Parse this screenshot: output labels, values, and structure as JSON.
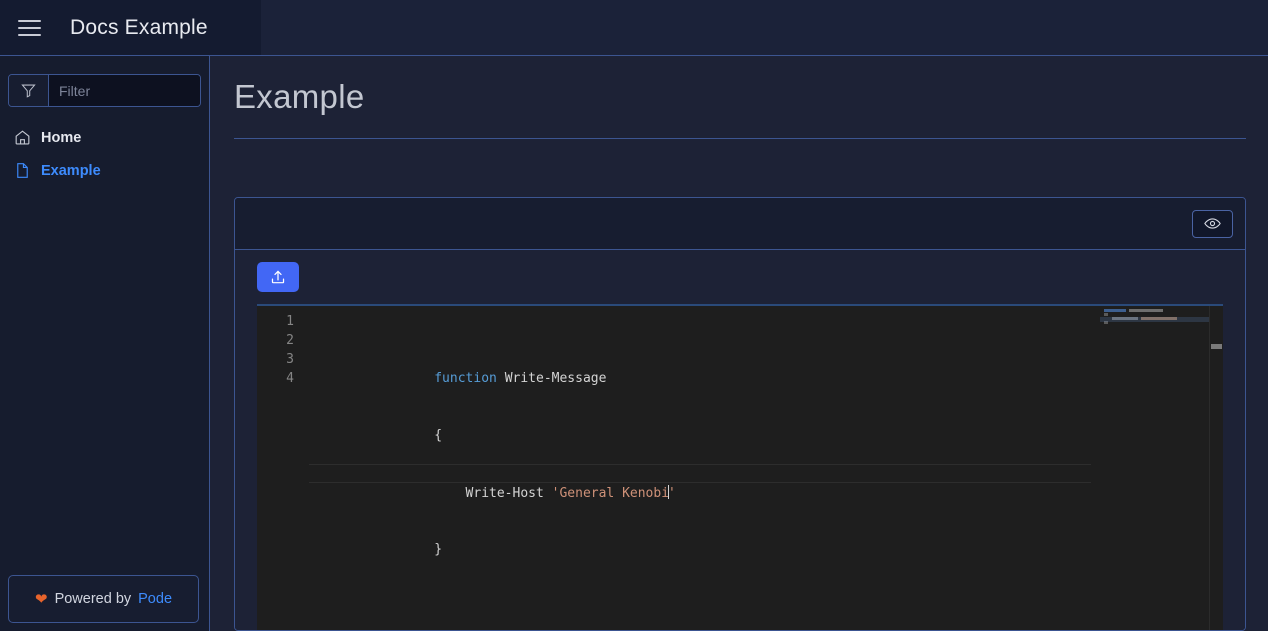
{
  "header": {
    "menu_icon": "hamburger-icon",
    "title": "Docs Example"
  },
  "sidebar": {
    "filter": {
      "icon": "funnel-icon",
      "placeholder": "Filter",
      "value": ""
    },
    "items": [
      {
        "label": "Home",
        "icon": "home-icon",
        "active": false
      },
      {
        "label": "Example",
        "icon": "file-icon",
        "active": true
      }
    ],
    "footer": {
      "heart": "❤",
      "text": "Powered by",
      "link": "Pode"
    }
  },
  "main": {
    "page_title": "Example",
    "card": {
      "header_button": {
        "icon": "eye-icon",
        "label": ""
      },
      "upload_button": {
        "icon": "upload-icon",
        "label": ""
      },
      "editor": {
        "language": "powershell",
        "line_numbers": [
          "1",
          "2",
          "3",
          "4"
        ],
        "lines": [
          {
            "num": "1",
            "tokens": [
              {
                "t": "function",
                "c": "kw"
              },
              {
                "t": " ",
                "c": "punc"
              },
              {
                "t": "Write-Message",
                "c": "fn"
              }
            ]
          },
          {
            "num": "2",
            "tokens": [
              {
                "t": "{",
                "c": "punc"
              }
            ]
          },
          {
            "num": "3",
            "tokens": [
              {
                "t": "    Write-Host ",
                "c": "fn"
              },
              {
                "t": "'General Kenobi",
                "c": "str"
              },
              {
                "t": "CARET",
                "c": "caret"
              },
              {
                "t": "'",
                "c": "str"
              }
            ]
          },
          {
            "num": "4",
            "tokens": [
              {
                "t": "}",
                "c": "punc"
              }
            ]
          }
        ],
        "raw": "function Write-Message\n{\n    Write-Host 'General Kenobi'\n}",
        "cursor_line": 3,
        "minimap_visible": true,
        "scrollbar_visible": true
      }
    }
  },
  "colors": {
    "accent_blue": "#3d8bfd",
    "button_blue": "#4267f5",
    "border_blue": "#3c5591",
    "sidebar_bg": "#161c2e",
    "main_bg": "#1d2236",
    "card_bg": "#171d30",
    "editor_bg": "#1e1e1e",
    "keyword": "#569cd6",
    "string": "#ce9178",
    "text": "#d4d4d4",
    "heart": "#e8642c"
  }
}
